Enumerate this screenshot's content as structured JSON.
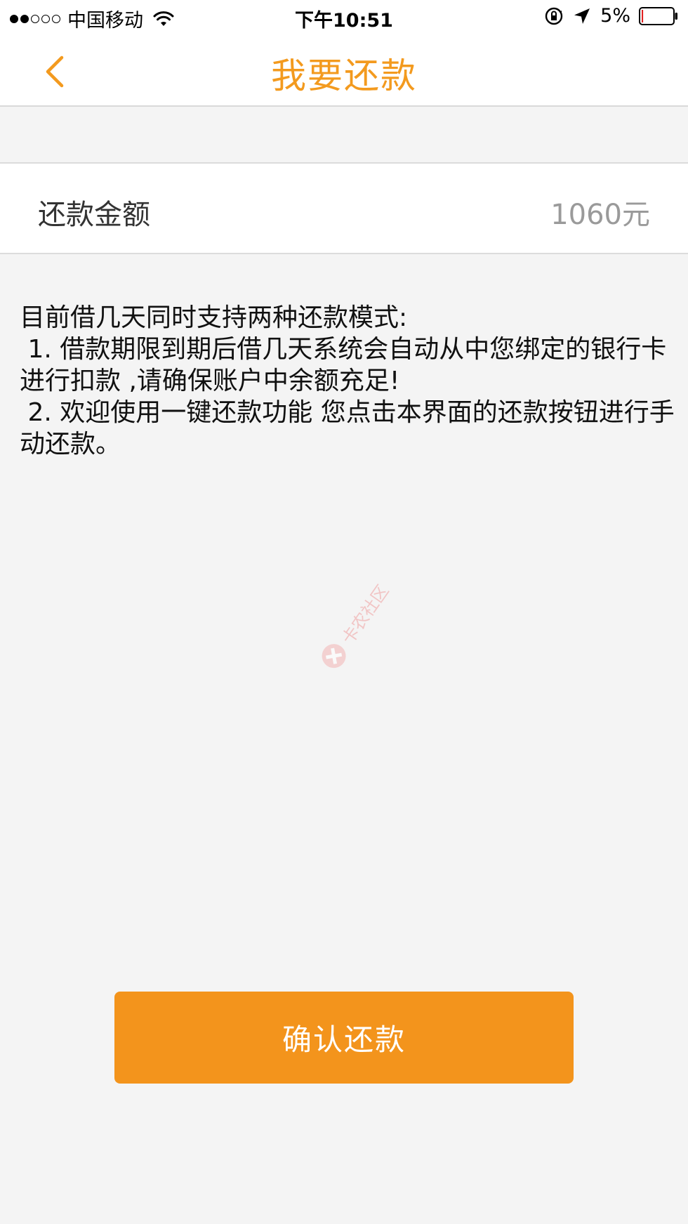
{
  "status_bar": {
    "signal_dots": [
      true,
      true,
      false,
      false,
      false
    ],
    "carrier": "中国移动",
    "time": "下午10:51",
    "battery_percent": "5%",
    "battery_level": 0.05
  },
  "nav": {
    "title": "我要还款",
    "accent_color": "#f39a1e"
  },
  "amount": {
    "label": "还款金额",
    "value": "1060元"
  },
  "info": {
    "lines": [
      "目前借几天同时支持两种还款模式:",
      " 1. 借款期限到期后借几天系统会自动从中您绑定的银行卡进行扣款 ,请确保账户中余额充足!",
      " 2. 欢迎使用一键还款功能 您点击本界面的还款按钮进行手动还款。"
    ]
  },
  "confirm_button": {
    "label": "确认还款",
    "color": "#f3941c"
  },
  "watermark": {
    "text": "卡农社区"
  }
}
